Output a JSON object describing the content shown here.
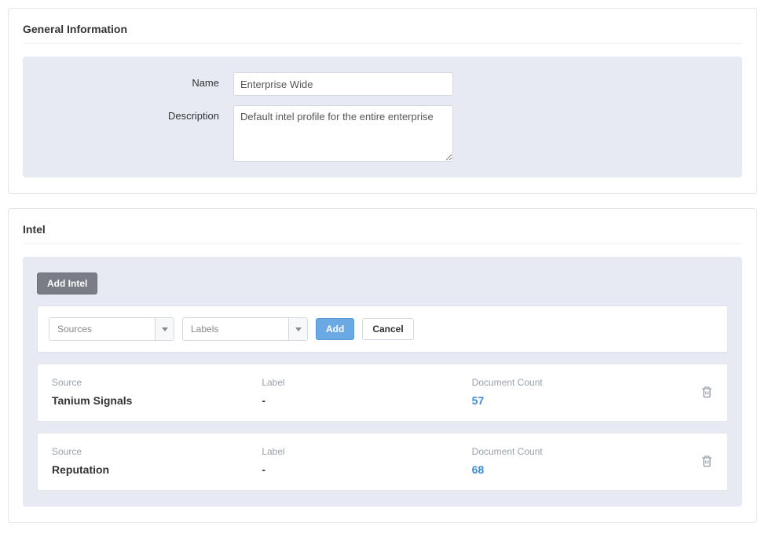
{
  "general": {
    "section_title": "General Information",
    "name_label": "Name",
    "name_value": "Enterprise Wide",
    "description_label": "Description",
    "description_value": "Default intel profile for the entire enterprise"
  },
  "intel": {
    "section_title": "Intel",
    "add_intel_label": "Add Intel",
    "sources_placeholder": "Sources",
    "labels_placeholder": "Labels",
    "add_button": "Add",
    "cancel_button": "Cancel",
    "headers": {
      "source": "Source",
      "label": "Label",
      "doc_count": "Document Count"
    },
    "rows": [
      {
        "source": "Tanium Signals",
        "label": "-",
        "doc_count": "57"
      },
      {
        "source": "Reputation",
        "label": "-",
        "doc_count": "68"
      }
    ]
  }
}
